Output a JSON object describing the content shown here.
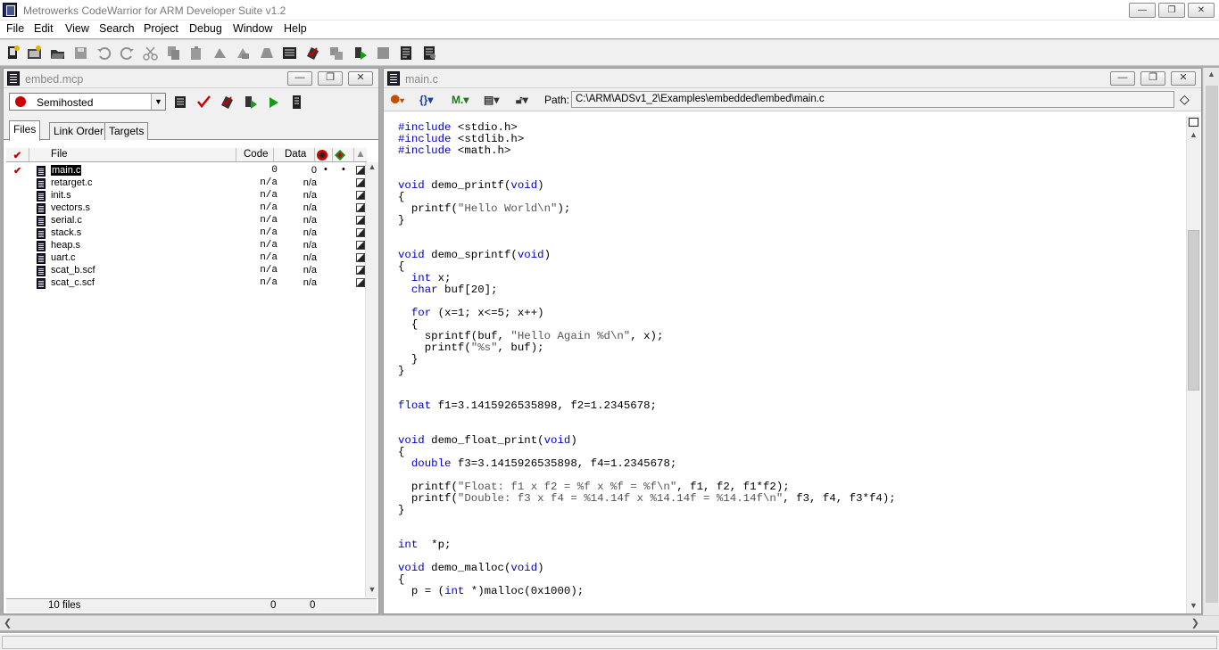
{
  "app": {
    "title": "Metrowerks CodeWarrior for ARM Developer Suite v1.2"
  },
  "window_buttons": {
    "minimize": "—",
    "restore": "❐",
    "close": "✕"
  },
  "menu": [
    "File",
    "Edit",
    "View",
    "Search",
    "Project",
    "Debug",
    "Window",
    "Help"
  ],
  "toolbar_icons": [
    "new-text-file-icon",
    "new-project-icon",
    "open-icon",
    "save-icon",
    "undo-icon",
    "redo-icon",
    "cut-icon",
    "copy-icon",
    "paste-icon",
    "bring-up-to-date-icon",
    "make-icon",
    "stop-icon",
    "find-icon",
    "compile-icon",
    "disassemble-icon",
    "debug-icon",
    "run-icon",
    "stop-build-icon",
    "preferences-icon",
    "target-settings-icon"
  ],
  "project": {
    "title": "embed.mcp",
    "target": "Semihosted",
    "tabs": [
      "Files",
      "Link Order",
      "Targets"
    ],
    "columns": {
      "file": "File",
      "code": "Code",
      "data": "Data"
    },
    "files": [
      {
        "name": "main.c",
        "code": "0",
        "data": "0",
        "selected": true,
        "checked": true,
        "dot1": "•",
        "dot2": "•"
      },
      {
        "name": "retarget.c",
        "code": "n/a",
        "data": "n/a"
      },
      {
        "name": "init.s",
        "code": "n/a",
        "data": "n/a"
      },
      {
        "name": "vectors.s",
        "code": "n/a",
        "data": "n/a"
      },
      {
        "name": "serial.c",
        "code": "n/a",
        "data": "n/a"
      },
      {
        "name": "stack.s",
        "code": "n/a",
        "data": "n/a"
      },
      {
        "name": "heap.s",
        "code": "n/a",
        "data": "n/a"
      },
      {
        "name": "uart.c",
        "code": "n/a",
        "data": "n/a"
      },
      {
        "name": "scat_b.scf",
        "code": "n/a",
        "data": "n/a"
      },
      {
        "name": "scat_c.scf",
        "code": "n/a",
        "data": "n/a"
      }
    ],
    "status": {
      "count": "10 files",
      "code_total": "0",
      "data_total": "0"
    }
  },
  "editor": {
    "title": "main.c",
    "path_label": "Path:",
    "path": "C:\\ARM\\ADSv1_2\\Examples\\embedded\\embed\\main.c",
    "code_lines": [
      "#include <stdio.h>",
      "#include <stdlib.h>",
      "#include <math.h>",
      "",
      "",
      "void demo_printf(void)",
      "{",
      "  printf(\"Hello World\\n\");",
      "}",
      "",
      "",
      "void demo_sprintf(void)",
      "{",
      "  int x;",
      "  char buf[20];",
      "",
      "  for (x=1; x<=5; x++)",
      "  {",
      "    sprintf(buf, \"Hello Again %d\\n\", x);",
      "    printf(\"%s\", buf);",
      "  }",
      "}",
      "",
      "",
      "float f1=3.1415926535898, f2=1.2345678;",
      "",
      "",
      "void demo_float_print(void)",
      "{",
      "  double f3=3.1415926535898, f4=1.2345678;",
      "",
      "  printf(\"Float: f1 x f2 = %f x %f = %f\\n\", f1, f2, f1*f2);",
      "  printf(\"Double: f3 x f4 = %14.14f x %14.14f = %14.14f\\n\", f3, f4, f3*f4);",
      "}",
      "",
      "",
      "int  *p;",
      "",
      "void demo_malloc(void)",
      "{",
      "  p = (int *)malloc(0x1000);"
    ]
  }
}
